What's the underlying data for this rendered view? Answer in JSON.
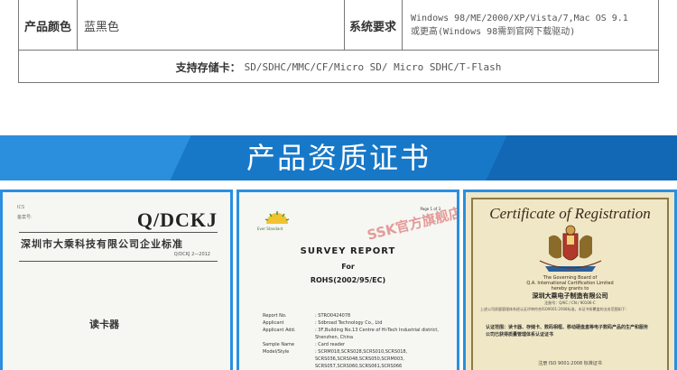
{
  "spec_table": {
    "color_label": "产品颜色",
    "color_value": "蓝黑色",
    "system_label": "系统要求",
    "system_value_line1": "Windows 98/ME/2000/XP/Vista/7,Mac OS 9.1",
    "system_value_line2": "或更高(Windows 98需到官网下载驱动)",
    "cards_label": "支持存储卡：",
    "cards_value": "SD/SDHC/MMC/CF/Micro SD/ Micro SDHC/T-Flash"
  },
  "section": {
    "title": "产品资质证书"
  },
  "certificates": {
    "cert1": {
      "ics": "ICS",
      "record": "备案号:",
      "code": "Q/DCKJ",
      "company": "深圳市大乘科技有限公司企业标准",
      "std_no": "Q/DCKJ 2—2012",
      "product": "读卡器"
    },
    "cert2": {
      "page_no": "Page 1 of 3",
      "logo_text": "Ever Standard",
      "title": "SURVEY  REPORT",
      "for": "For",
      "rohs": "ROHS(2002/95/EC)",
      "stamp": "SSK官方旗舰店",
      "rows": [
        {
          "k": "Report No.",
          "v": ": STRO0424078"
        },
        {
          "k": "Applicant",
          "v": ": Sdbroad Technology Co., Ltd"
        },
        {
          "k": "Applicant Add.",
          "v": ": 3F,Building No.13 Centre of Hi-Tech Industrial district,"
        },
        {
          "k": "",
          "v": "  Shenzhen, China"
        },
        {
          "k": "Sample Name",
          "v": ": Card reader"
        },
        {
          "k": "Model/Style",
          "v": ": SCRM018,SCRS028,SCRS010,SCRS018,"
        },
        {
          "k": "",
          "v": "  SCRS036,SCRS048,SCRS050,SCRM003,"
        },
        {
          "k": "",
          "v": "  SCRS057,SCRS060,SCRS061,SCRS066"
        }
      ]
    },
    "cert3": {
      "title": "Certificate of Registration",
      "gov_line1": "The Governing Board of",
      "gov_line2": "Q.A. International Certification Limited",
      "gov_line3": "hereby grants to",
      "company": "深圳大乘电子制造有限公司",
      "reg_no": "注册号：QAIC / CN / 90106-C",
      "body": "上述公司质量管理体系经认证评审符合ISO9001:2008标准，本证书所覆盖的业务范围如下：",
      "cn_line1": "认证范围：读卡器、存储卡、数码相框、移动硬盘盒等电子数码产品的生产和服务",
      "cn_line2": "公司已获得质量管理体系认证证书",
      "iso": "注册 ISO 9001:2008 标准证书"
    }
  }
}
